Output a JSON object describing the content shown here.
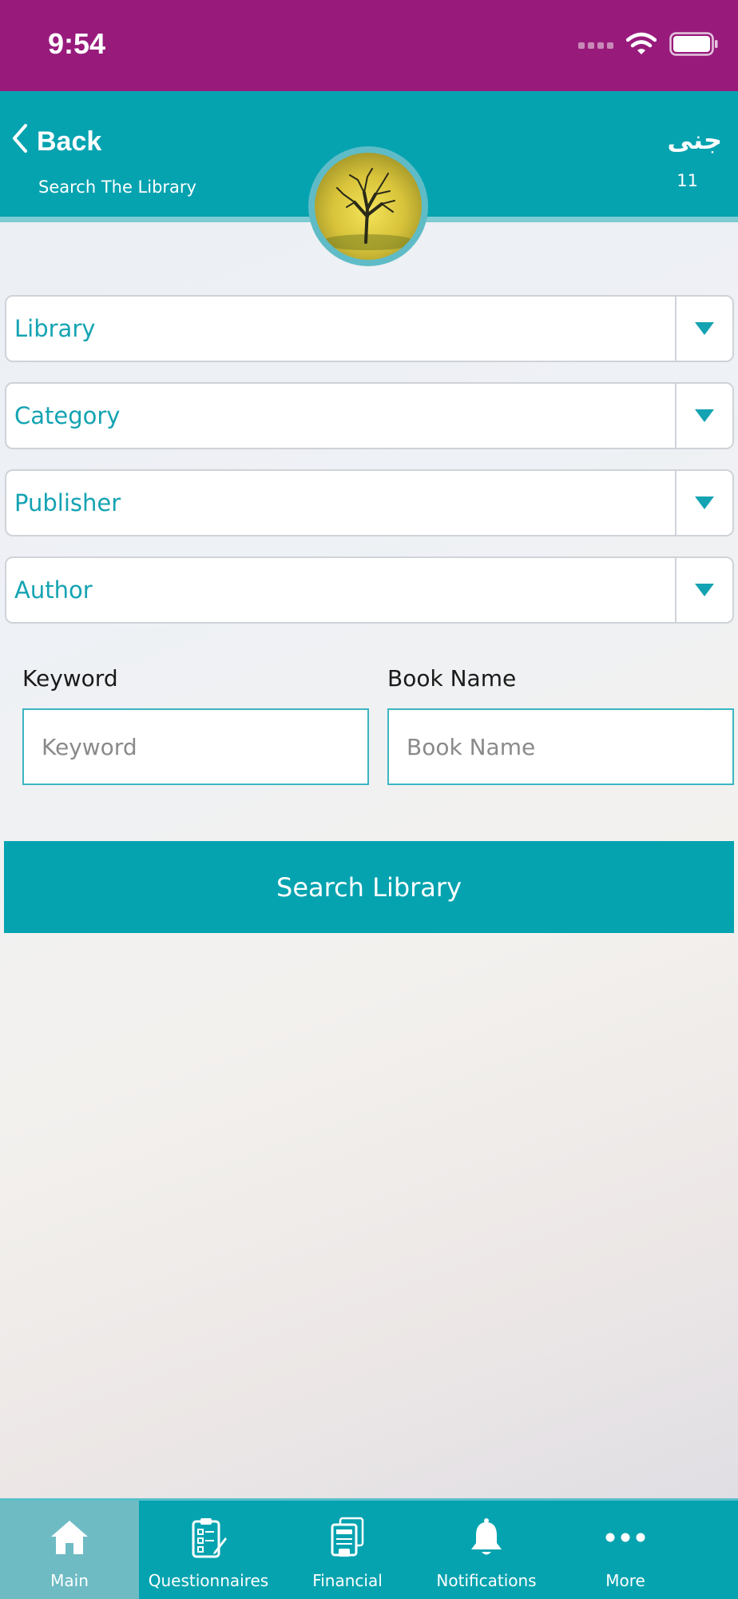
{
  "status_bar": {
    "time": "9:54"
  },
  "header": {
    "back_label": "Back",
    "subtitle": "Search The Library",
    "user_name": "جنى",
    "user_number": "11"
  },
  "filters": [
    {
      "label": "Library"
    },
    {
      "label": "Category"
    },
    {
      "label": "Publisher"
    },
    {
      "label": "Author"
    }
  ],
  "keyword": {
    "label": "Keyword",
    "placeholder": "Keyword"
  },
  "book_name": {
    "label": "Book Name",
    "placeholder": "Book Name"
  },
  "search_button": {
    "label": "Search Library"
  },
  "tabbar": {
    "items": [
      {
        "label": "Main",
        "icon": "home-icon",
        "active": true
      },
      {
        "label": "Questionnaires",
        "icon": "clipboard-icon",
        "active": false
      },
      {
        "label": "Financial",
        "icon": "receipt-icon",
        "active": false
      },
      {
        "label": "Notifications",
        "icon": "bell-icon",
        "active": false
      },
      {
        "label": "More",
        "icon": "more-icon",
        "active": false
      }
    ]
  },
  "colors": {
    "status_bar": "#981b7c",
    "teal": "#05a3b0",
    "label_teal": "#14a3b2",
    "active_tab": "#6ebbc4"
  }
}
